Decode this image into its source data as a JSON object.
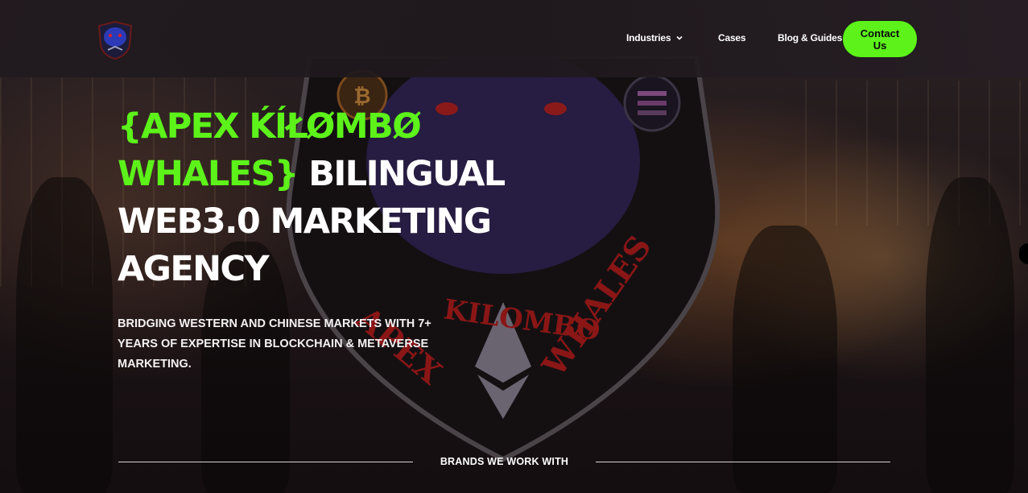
{
  "header": {
    "logo_icon": "wolf-shield-logo-icon",
    "nav": {
      "industries_label": "Industries",
      "cases_label": "Cases",
      "blog_label": "Blog & Guides"
    },
    "contact_label": "Contact Us"
  },
  "hero": {
    "headline_green": "{APEX ḰÍŁØMBØ WHALES}",
    "headline_white": " BILINGUAL WEB3.0 MARKETING AGENCY",
    "subheadline": "BRIDGING WESTERN AND CHINESE MARKETS WITH 7+ YEARS OF EXPERTISE IN BLOCKCHAIN & METAVERSE MARKETING.",
    "emblem_text_left": "APEX",
    "emblem_text_mid": "KILOMBO",
    "emblem_text_right": "WHALES"
  },
  "brands": {
    "label": "BRANDS WE WORK WITH"
  },
  "colors": {
    "accent_green": "#5cf21a",
    "emblem_red": "#a11a1a",
    "emblem_purple": "#2a1f4a"
  }
}
